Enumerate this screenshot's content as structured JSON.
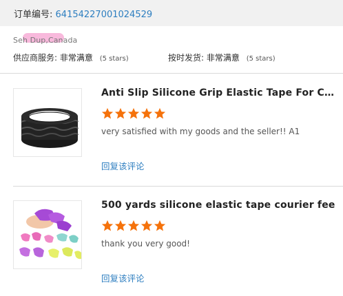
{
  "order": {
    "label": "订单编号:",
    "number": "64154227001024529"
  },
  "buyer": {
    "location": "Seh Dup,Canada"
  },
  "ratings": {
    "supplier_label": "供应商服务:",
    "supplier_value": "非常满意",
    "supplier_stars": "(5 stars)",
    "shipping_label": "按时发货:",
    "shipping_value": "非常满意",
    "shipping_stars": "(5 stars)"
  },
  "colors": {
    "link": "#2d7ec0",
    "star": "#f5720b",
    "header_bg": "#f1f1f1"
  },
  "reviews": [
    {
      "title": "Anti Slip Silicone Grip Elastic Tape For Clothing...",
      "rating": 5,
      "comment": "very satisfied with my goods and the seller!! A1",
      "reply_label": "回复该评论",
      "image_icon": "elastic-tape-roll-icon"
    },
    {
      "title": "500 yards silicone elastic tape courier fee",
      "rating": 5,
      "comment": "thank you very good!",
      "reply_label": "回复该评论",
      "image_icon": "silicone-finger-caps-icon"
    }
  ]
}
